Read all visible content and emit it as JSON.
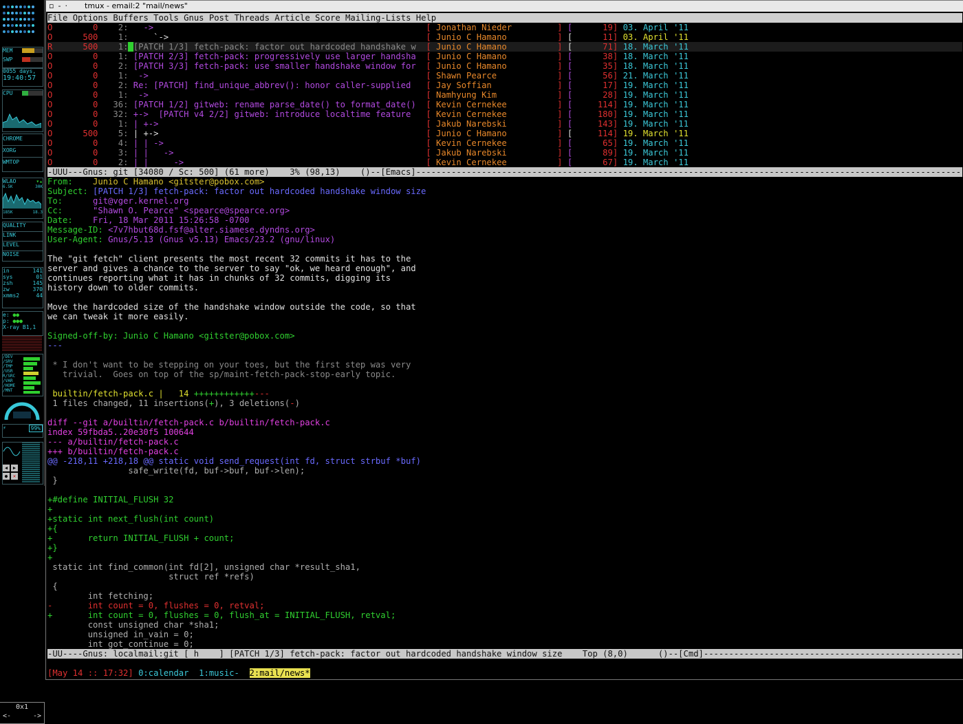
{
  "window": {
    "title": "tmux - email:2 \"mail/news\"",
    "buttons": [
      "▫",
      "-",
      "·"
    ]
  },
  "menu": [
    "File",
    "Options",
    "Buffers",
    "Tools",
    "Gnus",
    "Post",
    "Threads",
    "Article",
    "Score",
    "Mailing-Lists",
    "Help"
  ],
  "summary": [
    {
      "mark": "O",
      "score": "0",
      "thr": "2",
      "subj": "  ->",
      "author": "Jonathan Nieder",
      "lines": "19",
      "day": "03.",
      "month": "April",
      "year": "'11",
      "subj_color": "purple",
      "mark_color": "red",
      "score_color": "red",
      "author_color": "orange",
      "date_color": "cyan"
    },
    {
      "mark": "O",
      "score": "500",
      "thr": "1",
      "subj": "    `->",
      "author": "Junio C Hamano",
      "lines": "11",
      "day": "03.",
      "month": "April",
      "year": "'11",
      "subj_color": "white",
      "mark_color": "red",
      "score_color": "red",
      "author_color": "orange",
      "date_color": "yellow"
    },
    {
      "mark": "R",
      "score": "500",
      "thr": "1",
      "subj": "[PATCH 1/3] fetch-pack: factor out hardcoded handshake w",
      "author": "Junio C Hamano",
      "lines": "71",
      "day": "18.",
      "month": "March",
      "year": "'11",
      "subj_color": "dim",
      "mark_color": "red",
      "score_color": "red",
      "author_color": "orange",
      "date_color": "cyan",
      "selected": true
    },
    {
      "mark": "O",
      "score": "0",
      "thr": "1",
      "subj": "[PATCH 2/3] fetch-pack: progressively use larger handsha",
      "author": "Junio C Hamano",
      "lines": "38",
      "day": "18.",
      "month": "March",
      "year": "'11",
      "subj_color": "purple",
      "mark_color": "red",
      "score_color": "red",
      "author_color": "orange",
      "date_color": "cyan"
    },
    {
      "mark": "O",
      "score": "0",
      "thr": "2",
      "subj": "[PATCH 3/3] fetch-pack: use smaller handshake window for",
      "author": "Junio C Hamano",
      "lines": "35",
      "day": "18.",
      "month": "March",
      "year": "'11",
      "subj_color": "purple",
      "mark_color": "red",
      "score_color": "red",
      "author_color": "orange",
      "date_color": "cyan"
    },
    {
      "mark": "O",
      "score": "0",
      "thr": "1",
      "subj": " ->",
      "author": "Shawn Pearce",
      "lines": "56",
      "day": "21.",
      "month": "March",
      "year": "'11",
      "subj_color": "purple",
      "mark_color": "red",
      "score_color": "red",
      "author_color": "orange",
      "date_color": "cyan"
    },
    {
      "mark": "O",
      "score": "0",
      "thr": "2",
      "subj": "Re: [PATCH] find_unique_abbrev(): honor caller-supplied",
      "author": "Jay Soffian",
      "lines": "17",
      "day": "19.",
      "month": "March",
      "year": "'11",
      "subj_color": "purple",
      "mark_color": "red",
      "score_color": "red",
      "author_color": "orange",
      "date_color": "cyan"
    },
    {
      "mark": "O",
      "score": "0",
      "thr": "1",
      "subj": " ->",
      "author": "Namhyung Kim",
      "lines": "28",
      "day": "19.",
      "month": "March",
      "year": "'11",
      "subj_color": "purple",
      "mark_color": "red",
      "score_color": "red",
      "author_color": "orange",
      "date_color": "cyan"
    },
    {
      "mark": "O",
      "score": "0",
      "thr": "36",
      "subj": "[PATCH 1/2] gitweb: rename parse_date() to format_date()",
      "author": "Kevin Cernekee",
      "lines": "114",
      "day": "19.",
      "month": "March",
      "year": "'11",
      "subj_color": "purple",
      "mark_color": "red",
      "score_color": "red",
      "author_color": "orange",
      "date_color": "cyan"
    },
    {
      "mark": "O",
      "score": "0",
      "thr": "32",
      "subj": "+->  [PATCH v4 2/2] gitweb: introduce localtime feature",
      "author": "Kevin Cernekee",
      "lines": "180",
      "day": "19.",
      "month": "March",
      "year": "'11",
      "subj_color": "purple",
      "mark_color": "red",
      "score_color": "red",
      "author_color": "orange",
      "date_color": "cyan"
    },
    {
      "mark": "O",
      "score": "0",
      "thr": "1",
      "subj": "| +->",
      "author": "Jakub Narebski",
      "lines": "143",
      "day": "19.",
      "month": "March",
      "year": "'11",
      "subj_color": "purple",
      "mark_color": "red",
      "score_color": "red",
      "author_color": "orange",
      "date_color": "cyan"
    },
    {
      "mark": "O",
      "score": "500",
      "thr": "5",
      "subj": "| +->",
      "author": "Junio C Hamano",
      "lines": "114",
      "day": "19.",
      "month": "March",
      "year": "'11",
      "subj_color": "white",
      "mark_color": "red",
      "score_color": "red",
      "author_color": "orange",
      "date_color": "yellow"
    },
    {
      "mark": "O",
      "score": "0",
      "thr": "4",
      "subj": "| | ->",
      "author": "Kevin Cernekee",
      "lines": "65",
      "day": "19.",
      "month": "March",
      "year": "'11",
      "subj_color": "purple",
      "mark_color": "red",
      "score_color": "red",
      "author_color": "orange",
      "date_color": "cyan"
    },
    {
      "mark": "O",
      "score": "0",
      "thr": "3",
      "subj": "| |   ->",
      "author": "Jakub Narebski",
      "lines": "89",
      "day": "19.",
      "month": "March",
      "year": "'11",
      "subj_color": "purple",
      "mark_color": "red",
      "score_color": "red",
      "author_color": "orange",
      "date_color": "cyan"
    },
    {
      "mark": "O",
      "score": "0",
      "thr": "2",
      "subj": "| |     ->",
      "author": "Kevin Cernekee",
      "lines": "67",
      "day": "19.",
      "month": "March",
      "year": "'11",
      "subj_color": "purple",
      "mark_color": "red",
      "score_color": "red",
      "author_color": "orange",
      "date_color": "cyan"
    }
  ],
  "summary_modeline": "-UUU---Gnus: git [34080 / Sc: 500] (61 more)    3% (98,13)    ()--[Emacs]-----------------------------------------------------------------------------------------------------------------------",
  "headers": [
    {
      "key": "From:",
      "pad": "    ",
      "value": "Junio C Hamano <gitster@pobox.com>",
      "value_color": "gold"
    },
    {
      "key": "Subject:",
      "pad": " ",
      "value": "[PATCH 1/3] fetch-pack: factor out hardcoded handshake window size",
      "value_color": "blue"
    },
    {
      "key": "To:",
      "pad": "      ",
      "value": "git@vger.kernel.org",
      "value_color": "purple"
    },
    {
      "key": "Cc:",
      "pad": "      ",
      "value": "\"Shawn O. Pearce\" <spearce@spearce.org>",
      "value_color": "purple"
    },
    {
      "key": "Date:",
      "pad": "    ",
      "value": "Fri, 18 Mar 2011 15:26:58 -0700",
      "value_color": "purple"
    },
    {
      "key": "Message-ID:",
      "pad": " ",
      "value": "<7v7hbut68d.fsf@alter.siamese.dyndns.org>",
      "value_color": "purple"
    },
    {
      "key": "User-Agent:",
      "pad": " ",
      "value": "Gnus/5.13 (Gnus v5.13) Emacs/23.2 (gnu/linux)",
      "value_color": "purple"
    }
  ],
  "body": [
    {
      "t": "",
      "c": "white"
    },
    {
      "t": "The \"git fetch\" client presents the most recent 32 commits it has to the",
      "c": "white"
    },
    {
      "t": "server and gives a chance to the server to say \"ok, we heard enough\", and",
      "c": "white"
    },
    {
      "t": "continues reporting what it has in chunks of 32 commits, digging its",
      "c": "white"
    },
    {
      "t": "history down to older commits.",
      "c": "white"
    },
    {
      "t": "",
      "c": "white"
    },
    {
      "t": "Move the hardcoded size of the handshake window outside the code, so that",
      "c": "white"
    },
    {
      "t": "we can tweak it more easily.",
      "c": "white"
    },
    {
      "t": "",
      "c": "white"
    },
    {
      "t": "Signed-off-by: Junio C Hamano <gitster@pobox.com>",
      "c": "green"
    },
    {
      "t": "---",
      "c": "blue"
    },
    {
      "t": "",
      "c": "white"
    },
    {
      "t": " * I don't want to be stepping on your toes, but the first step was very",
      "c": "dim"
    },
    {
      "t": "   trivial.  Goes on top of the sp/maint-fetch-pack-stop-early topic.",
      "c": "dim"
    },
    {
      "t": "",
      "c": "white"
    },
    {
      "t": " builtin/fetch-pack.c |   14 ++++++++++++---",
      "c": "diffstat"
    },
    {
      "t": " 1 files changed, 11 insertions(+), 3 deletions(-)",
      "c": "diffstat2"
    },
    {
      "t": "",
      "c": "white"
    },
    {
      "t": "diff --git a/builtin/fetch-pack.c b/builtin/fetch-pack.c",
      "c": "magenta"
    },
    {
      "t": "index 59fbda5..20e30f5 100644",
      "c": "magenta"
    },
    {
      "t": "--- a/builtin/fetch-pack.c",
      "c": "magenta"
    },
    {
      "t": "+++ b/builtin/fetch-pack.c",
      "c": "magenta"
    },
    {
      "t": "@@ -218,11 +218,18 @@ static void send_request(int fd, struct strbuf *buf)",
      "c": "blue"
    },
    {
      "t": "                safe_write(fd, buf->buf, buf->len);",
      "c": "gray"
    },
    {
      "t": " }",
      "c": "gray"
    },
    {
      "t": "",
      "c": "white"
    },
    {
      "t": "+#define INITIAL_FLUSH 32",
      "c": "green"
    },
    {
      "t": "+",
      "c": "green"
    },
    {
      "t": "+static int next_flush(int count)",
      "c": "green"
    },
    {
      "t": "+{",
      "c": "green"
    },
    {
      "t": "+       return INITIAL_FLUSH + count;",
      "c": "green"
    },
    {
      "t": "+}",
      "c": "green"
    },
    {
      "t": "+",
      "c": "green"
    },
    {
      "t": " static int find_common(int fd[2], unsigned char *result_sha1,",
      "c": "gray"
    },
    {
      "t": "                        struct ref *refs)",
      "c": "gray"
    },
    {
      "t": " {",
      "c": "gray"
    },
    {
      "t": "        int fetching;",
      "c": "gray"
    },
    {
      "t": "-       int count = 0, flushes = 0, retval;",
      "c": "red"
    },
    {
      "t": "+       int count = 0, flushes = 0, flush_at = INITIAL_FLUSH, retval;",
      "c": "green"
    },
    {
      "t": "        const unsigned char *sha1;",
      "c": "gray"
    },
    {
      "t": "        unsigned in_vain = 0;",
      "c": "gray"
    },
    {
      "t": "        int got_continue = 0;",
      "c": "gray"
    }
  ],
  "article_modeline": "-UU----Gnus: localmail:git [ h    ] [PATCH 1/3] fetch-pack: factor out hardcoded handshake window size    Top (8,0)      ()--[Cmd]-------------------------------------------------------",
  "tmux": {
    "clock": "[May 14 :: 17:32]",
    "windows": [
      {
        "label": "0:calendar",
        "active": false
      },
      {
        "label": "1:music-",
        "active": false
      },
      {
        "label": "2:mail/news*",
        "active": true
      }
    ]
  },
  "dock": {
    "mem_label": "MEM",
    "swp_label": "SWP",
    "uptime_days": "0055 days,",
    "uptime_time": "19:40:57",
    "cpu_label": "CPU",
    "procs": [
      "CHROME",
      "XORG",
      "WMTOP"
    ],
    "wlan_label": "WLAO",
    "wlan_rate_a": "6.5K",
    "wlan_rate_b": "30K",
    "wlan_rate_c": "18.3",
    "wlan_rate_d": "185K",
    "wlan_rate_e": "5K",
    "quality_label": "QUALITY",
    "link_label": "LINK",
    "level_label": "LEVEL",
    "noise_label": "NOISE",
    "load": [
      {
        "k": "in",
        "v": "141"
      },
      {
        "k": "sys",
        "v": "01"
      },
      {
        "k": "zsh",
        "v": "145"
      },
      {
        "k": "zw",
        "v": "370"
      },
      {
        "k": "xmms2",
        "v": "44"
      }
    ],
    "mail_a": "e:",
    "mail_b": "p:",
    "xray": "X-ray B1,1",
    "disks": [
      "/DEV",
      "/SRV",
      "/TMP",
      "/USR",
      "R/SRC",
      "/VAR",
      "/HOME",
      "/MNT"
    ],
    "battery": "99%",
    "bottom_top": "0x1",
    "bottom_left": "<-",
    "bottom_right": "->"
  },
  "colors": {
    "green": "#30d030",
    "red": "#e03030",
    "cyan": "#3cc8d8",
    "purple": "#b24ae0",
    "orange": "#e8882a",
    "yellow": "#e0e030"
  }
}
